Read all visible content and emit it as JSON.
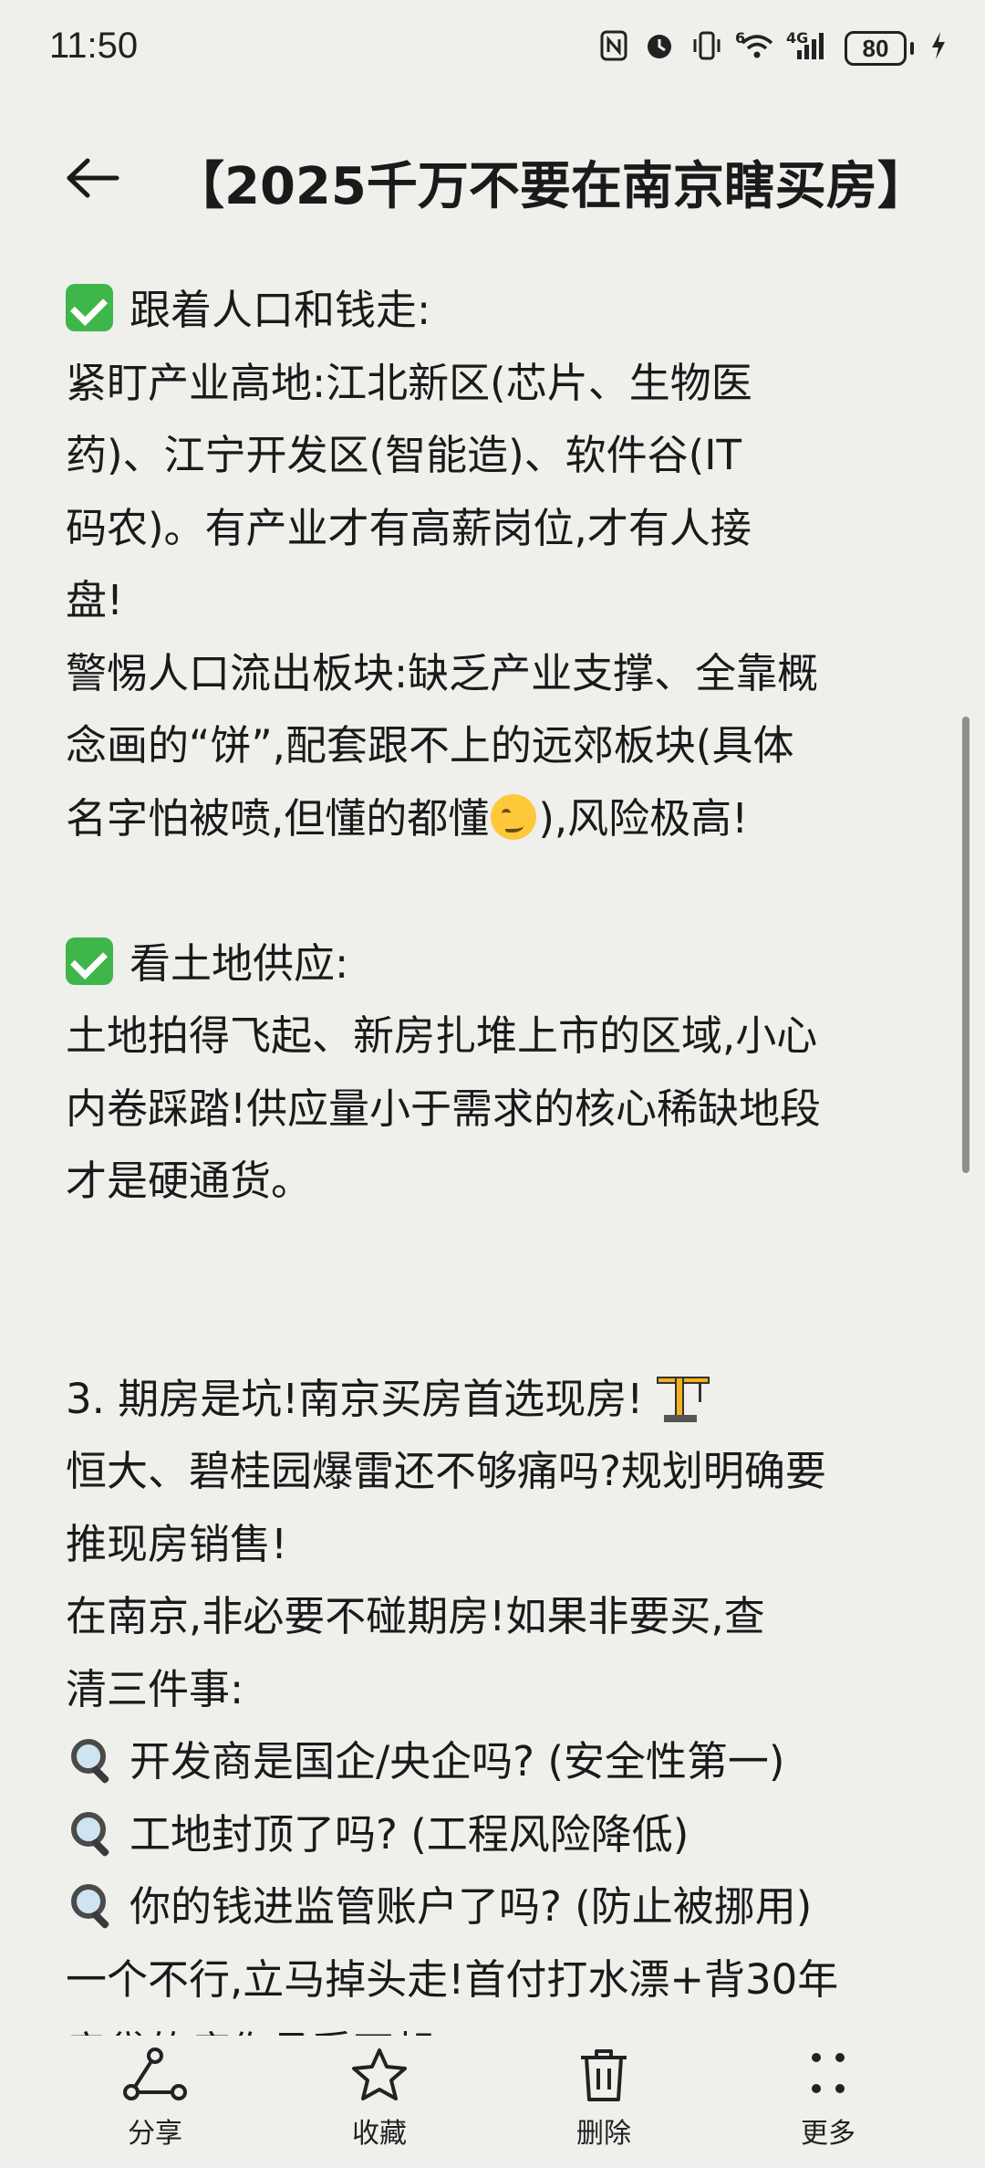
{
  "status_bar": {
    "time": "11:50",
    "icons": [
      "nfc-icon",
      "alarm-icon",
      "vibrate-icon",
      "wifi-icon",
      "signal-icon",
      "charging-icon"
    ],
    "network_label": "4G",
    "wifi_label": "6",
    "battery": "80"
  },
  "header": {
    "title": "【2025千万不要在南京瞎买房】"
  },
  "content": {
    "lines": [
      "跟着人口和钱走:",
      "紧盯产业高地:江北新区(芯片、生物医",
      "药)、江宁开发区(智能造)、软件谷(IT",
      "码农)。有产业才有高薪岗位,才有人接",
      "盘!",
      "警惕人口流出板块:缺乏产业支撑、全靠概",
      "念画的“饼”,配套跟不上的远郊板块(具体",
      "名字怕被喷,但懂的都懂",
      "),风险极高!",
      "看土地供应:",
      "土地拍得飞起、新房扎堆上市的区域,小心",
      "内卷踩踏!供应量小于需求的核心稀缺地段",
      "才是硬通货。",
      "3. 期房是坑!南京买房首选现房!",
      "恒大、碧桂园爆雷还不够痛吗?规划明确要",
      "推现房销售!",
      "在南京,非必要不碰期房!如果非要买,查",
      "清三件事:",
      "开发商是国企/央企吗? (安全性第一)",
      "工地封顶了吗? (工程风险降低)",
      "你的钱进监管账户了吗? (防止被挪用)",
      "一个不行,立马掉头走!首付打水漂+背30年",
      "房贷的痛你承受不起!"
    ]
  },
  "bottom_bar": {
    "share": "分享",
    "favorite": "收藏",
    "delete": "删除",
    "more": "更多"
  }
}
